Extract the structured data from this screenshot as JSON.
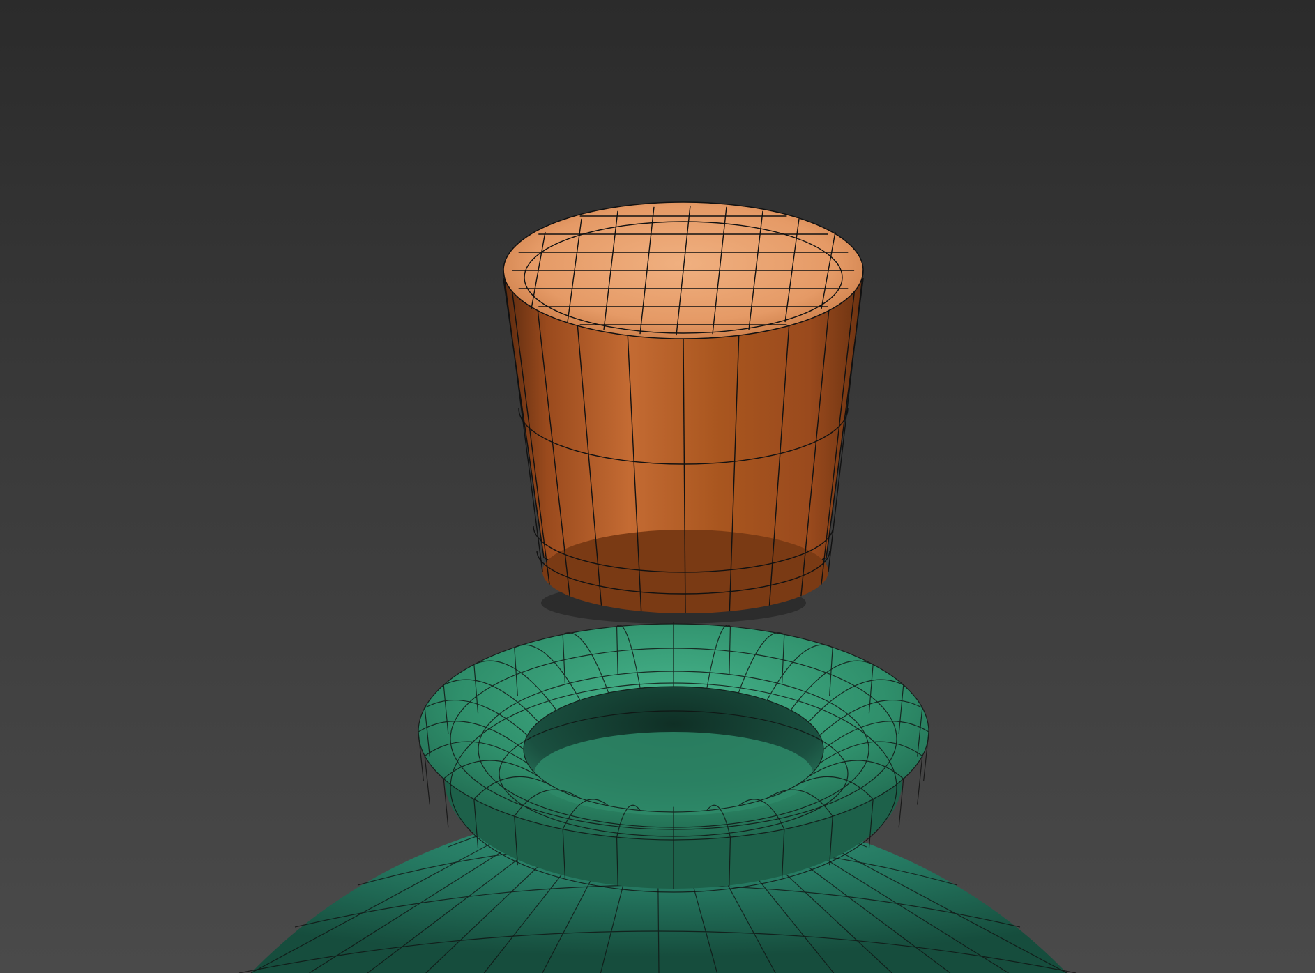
{
  "viewport": {
    "background_top": "#2b2b2b",
    "background_bottom": "#4a4a4a"
  },
  "objects": [
    {
      "name": "cork-stopper",
      "kind": "cylinder",
      "colors": {
        "top": "#e9a06f",
        "top_shadow": "#d08050",
        "side_light": "#c46b33",
        "side_mid": "#9a4a1d",
        "side_dark": "#5b2a0f"
      }
    },
    {
      "name": "bottle-neck-ring",
      "kind": "torus",
      "colors": {
        "light": "#3aa57e",
        "mid": "#2c8a68",
        "dark": "#1b5e46"
      }
    },
    {
      "name": "bottle-body",
      "kind": "sphere",
      "colors": {
        "light": "#2f8c70",
        "mid": "#22705a",
        "dark": "#164d3d"
      }
    }
  ],
  "wireframe": {
    "color": "#0f0f0f"
  }
}
